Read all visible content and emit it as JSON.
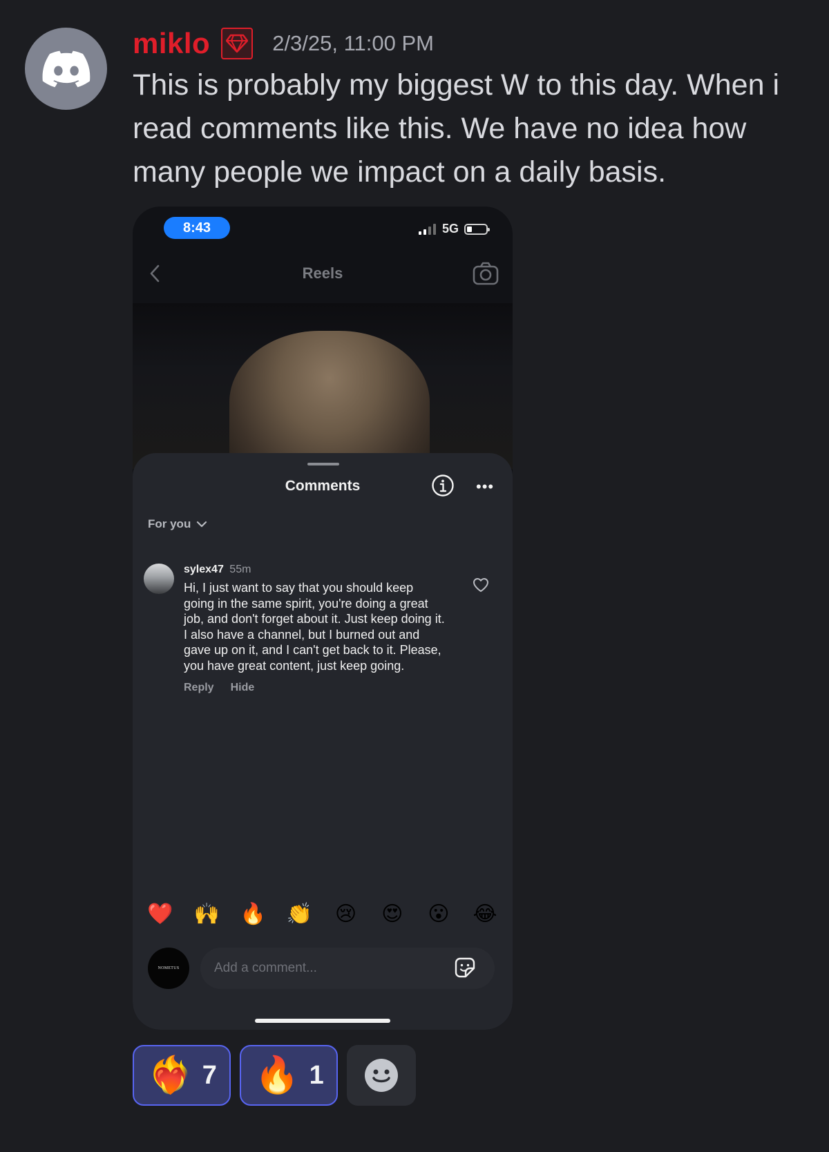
{
  "message": {
    "username": "miklo",
    "username_color": "#e01e2a",
    "badge_icon": "gem-icon",
    "timestamp": "2/3/25, 11:00 PM",
    "text": "This is probably my biggest W to this day. When i read comments like this. We have no idea how many people we impact on a daily basis."
  },
  "screenshot": {
    "status_bar": {
      "time": "8:43",
      "network": "5G"
    },
    "nav": {
      "title": "Reels"
    },
    "comments_sheet": {
      "title": "Comments",
      "filter": "For you",
      "comment": {
        "user": "sylex47",
        "time": "55m",
        "text": "Hi, I just want to say that you should keep going in the same spirit, you're doing a great job, and don't forget about it. Just keep doing it. I also have a channel, but I burned out and gave up on it, and I can't get back to it. Please, you have great content, just keep going.",
        "reply_label": "Reply",
        "hide_label": "Hide"
      },
      "quick_emojis": [
        "❤️",
        "🙌",
        "🔥",
        "👏",
        "😢",
        "😍",
        "😮",
        "😂"
      ],
      "input_placeholder": "Add a comment...",
      "self_avatar_text": "NOMETUS"
    }
  },
  "reactions": [
    {
      "emoji": "❤️‍🔥",
      "count": "7",
      "active": true
    },
    {
      "emoji": "🔥",
      "count": "1",
      "active": true
    }
  ],
  "colors": {
    "background": "#1c1d21",
    "reaction_active_bg": "#353a6b",
    "reaction_active_border": "#5865f2"
  }
}
